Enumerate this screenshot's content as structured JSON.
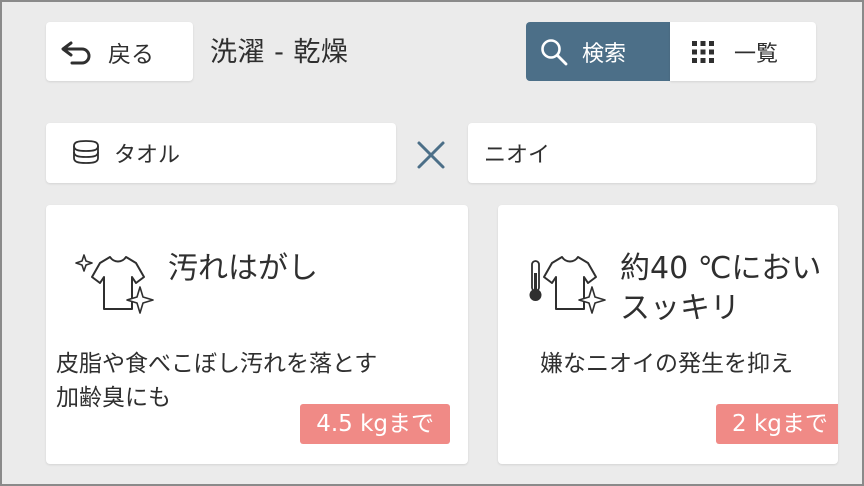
{
  "header": {
    "back_label": "戻る",
    "title": "洗濯 - 乾燥",
    "search_label": "検索",
    "list_label": "一覧",
    "accent_color": "#4c6f88"
  },
  "filters": {
    "first": {
      "label": "タオル",
      "icon": "towel-stack-icon"
    },
    "operator_icon": "cross-icon",
    "second": {
      "label": "ニオイ"
    }
  },
  "courses": [
    {
      "title_line1": "汚れはがし",
      "title_line2": "",
      "icon": "sparkle-shirt-icon",
      "desc_line1": "皮脂や食べこぼし汚れを落とす",
      "desc_line2": "加齢臭にも",
      "capacity": "4.5 kgまで"
    },
    {
      "title_line1": "約40 ℃におい",
      "title_line2": "スッキリ",
      "icon": "thermometer-shirt-icon",
      "desc_line1": "嫌なニオイの発生を抑え",
      "desc_line2": "",
      "capacity": "2 kgまで"
    }
  ],
  "badge_color": "#f08a86"
}
